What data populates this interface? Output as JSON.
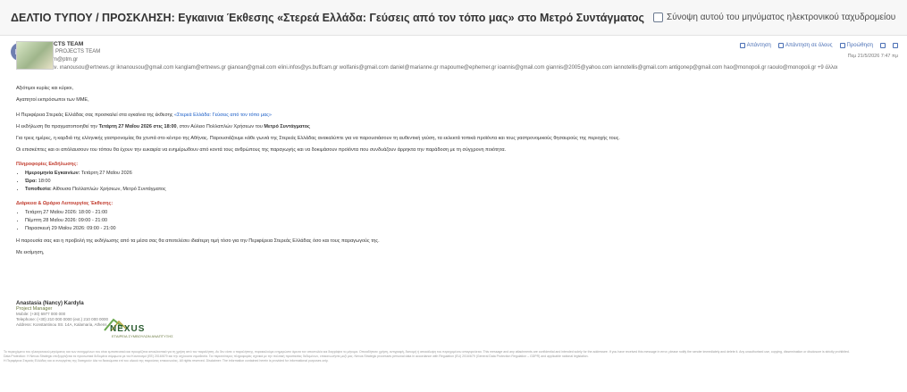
{
  "subject": "ΔΕΛΤΙΟ ΤΥΠΟΥ / ΠΡΟΣΚΛΗΣΗ: Εγκαινια Έκθεσης «Στερεά Ελλάδα: Γεύσεις από τον τόπο μας» στο Μετρό Συντάγματος",
  "summary_label": "Σύνοψη αυτού του μηνύματος ηλεκτρονικού ταχυδρομείου",
  "header": {
    "avatar_initials": "PT",
    "from": "PROJECTS TEAM",
    "to": "Προς: ⊕ PROJECTS TEAM",
    "bcc": "bcc: ptam@ptm.gr",
    "cc": "Κοιν. κοιν.  ιnanousou@ertnews.gr  iknanousou@gmail.com  kanglam@ertnews.gr  gianoan@gmail.com  elini.infos@ys.buffcam.gr  wolfanis@gmail.com  daniel@marianne.gr  mapoume@ephemer.gr  ioannis@gmail.com  giannis@2005@yahoo.com  iannotellis@gmail.com  antigonep@gmail.com  hao@monopoli.gr  raoulo@monopoli.gr  +9 άλλοι",
    "actions": [
      "Απάντηση",
      "Απάντηση σε όλους",
      "Προώθηση"
    ],
    "date": "Πεμ 21/5/2026 7:47 πμ"
  },
  "body": {
    "greeting1": "Αξιότιμοι κυρίες και κύριοι,",
    "greeting2": "Αγαπητοί εκπρόσωποι των ΜΜΕ,",
    "p1_a": "Η Περιφέρεια Στερεάς Ελλάδας σας προσκαλεί στα εγκαίνια της έκθεσης ",
    "p1_link": "«Στερεά Ελλάδα: Γεύσεις από τον τόπο μας»",
    "p2_a": "Η εκδήλωση θα πραγματοποιηθεί την ",
    "p2_b": "Τετάρτη 27 Μαΐου 2026 στις 18:00",
    "p2_c": ", στον Αύλειο Πολλαπλών Χρήσεων του ",
    "p2_d": "Μετρό Συντάγματος",
    "p3": "Για τρεις ημέρες, η καρδιά της ελληνικής γαστρονομίας θα χτυπά στο κέντρο της Αθήνας. Παρουσιάζουμε κάθε γωνιά της Στερεάς Ελλάδας ανακαλύπτε για να παρουσιάσουν τη αυθεντική γεύση, τα εκλεκτά τοπικά προϊόντα και τους γαστρονομικούς θησαυρούς της περιοχής τους.",
    "p4": "Οι επισκέπτες και οι απόλαυσουν του τόπου θα έχουν την ευκαιρία να ενημέρωθουν από κοντά τους ανθρώπους της παραγωγής και να δοκιμάσουν προϊόντα που συνδυάζουν άρρηκτα την παράδοση με τη σύγχρονη ποιότητα.",
    "sec1": "Πληροφορίες Εκδήλωσης:",
    "info": [
      {
        "k": "Ημερομηνία Εγκαινίων:",
        "v": " Τετάρτη 27 Μαΐου 2026"
      },
      {
        "k": "Ώρα:",
        "v": " 18:00"
      },
      {
        "k": "Τοποθεσία:",
        "v": " Αίθουσα Πολλαπλών Χρήσεων, Μετρό Συντάγματος"
      }
    ],
    "sec2": "Διάρκεια & Ωράριο Λειτουργίας Έκθεσης:",
    "hours": [
      "Τετάρτη 27 Μαΐου 2026: 18:00 - 21:00",
      "Πέμπτη 28 Μαΐου 2026: 09:00 - 21:00",
      "Παρασκευή 29 Μαΐου 2026: 09:00 - 21:00"
    ],
    "closing": "Η παρουσία σας και η προβολή της εκδήλωσης από τα μέσα σας θα αποτελέσει ιδιαίτερη τιμή τόσο για την Περιφέρεια Στερεάς Ελλάδας όσο και τους παραγωγούς της.",
    "regards": "Με εκτίμηση,"
  },
  "signature": {
    "name": "Anastasia (Nancy) Kardyla",
    "role": "Project Manager",
    "lines": [
      "Mobile: (+30) 6977 000 000",
      "Telephone: (+30) 210 000 0000 (ext.) 210 000 0000",
      "Address: Konstantinou Str. 14A, Kalamaria, Athens"
    ]
  },
  "logo": {
    "word": "NEXUS",
    "tag": "ΕΤΑΙΡΕΙΑ ΣΥΜΒΟΥΛΩΝ ΑΝΑΠΤΥΞΗΣ"
  },
  "footer": [
    "Το περιεχόμενο του ηλεκτρονικού μηνύματος και των συνημμένων του είναι εμπιστευτικό και προορίζεται αποκλειστικά για τη χρήση από τον παραλήπτη. Αν δεν είστε ο παραλήπτης, παρακαλούμε ενημερώστε άμεσα τον αποστολέα και διαγράψτε το μήνυμα. Οποιαδήποτε χρήση, αντιγραφή, διανομή ή αποκάλυψη του περιεχομένου απαγορεύεται. This message and any attachments are confidential and intended solely for the addressee. If you have received this message in error, please notify the sender immediately and delete it. Any unauthorised use, copying, dissemination or disclosure is strictly prohibited.",
    "Data Protection: Η Nexus Strategic επεξεργάζεται τα προσωπικά δεδομένα σύμφωνα με τον Κανονισμό (ΕΕ) 2016/679 και την ισχύουσα νομοθεσία. Για περισσότερες πληροφορίες σχετικά με την πολιτική προστασίας δεδομένων, επικοινωνήστε μαζί μας. Nexus Strategic processes personal data in accordance with Regulation (EU) 2016/679 (General Data Protection Regulation – GDPR) and applicable national legislation.",
    "Η Περιφέρεια Στερεάς Ελλάδας και οι συνεργάτες της διατηρούν όλα τα δικαιώματα επί του υλικού της παρούσας επικοινωνίας. All rights reserved. Disclaimer: The information contained herein is provided for informational purposes only."
  ]
}
